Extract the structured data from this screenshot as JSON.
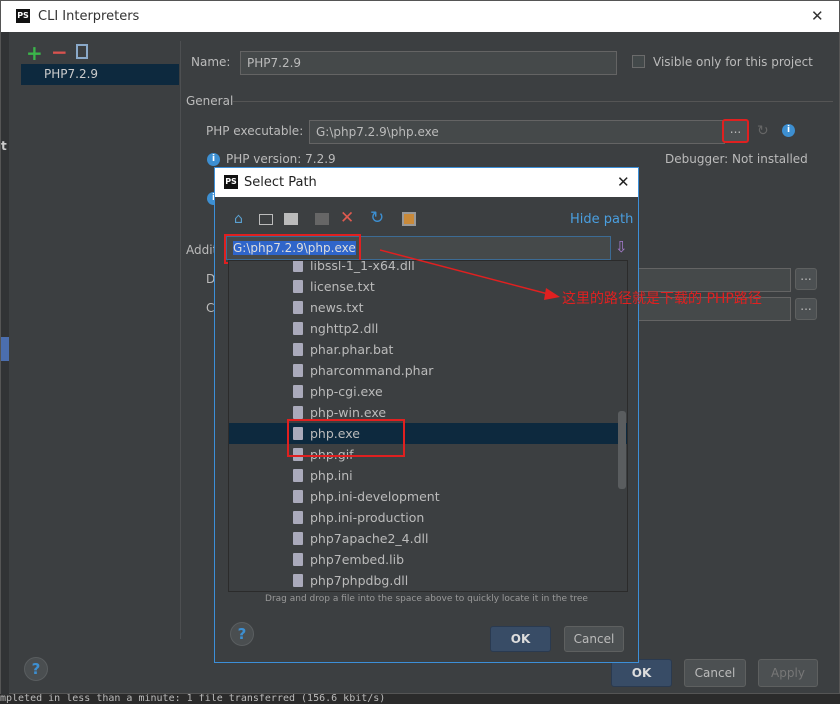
{
  "window": {
    "title": "CLI Interpreters",
    "close": "✕"
  },
  "sidebar": {
    "items": [
      {
        "label": "PHP7.2.9"
      }
    ],
    "side_letter": "t"
  },
  "form": {
    "name_label": "Name:",
    "name_value": "PHP7.2.9",
    "visible_only_label": "Visible only for this project",
    "general_label": "General",
    "php_exec_label": "PHP executable:",
    "php_exec_value": "G:\\php7.2.9\\php.exe",
    "browse": "...",
    "php_version": "PHP version: 7.2.9",
    "debugger": "Debugger: Not installed",
    "additional_label": "Addit",
    "d_label": "D",
    "c_label": "C"
  },
  "buttons": {
    "ok": "OK",
    "cancel": "Cancel",
    "apply": "Apply",
    "help": "?"
  },
  "status_bar": "mpleted in less than a minute: 1 file transferred (156.6 kbit/s)",
  "dialog": {
    "title": "Select Path",
    "close": "✕",
    "hide_path": "Hide path",
    "path_value": "G:\\php7.2.9\\php.exe",
    "files": [
      "libssl-1_1-x64.dll",
      "license.txt",
      "news.txt",
      "nghttp2.dll",
      "phar.phar.bat",
      "pharcommand.phar",
      "php-cgi.exe",
      "php-win.exe",
      "php.exe",
      "php.gif",
      "php.ini",
      "php.ini-development",
      "php.ini-production",
      "php7apache2_4.dll",
      "php7embed.lib",
      "php7phpdbg.dll"
    ],
    "selected": "php.exe",
    "hint": "Drag and drop a file into the space above to quickly locate it in the tree",
    "ok": "OK",
    "cancel": "Cancel",
    "help": "?"
  },
  "annotation": {
    "text": "这里的路径就是下载的 PHP路径",
    "color": "#e02020"
  }
}
